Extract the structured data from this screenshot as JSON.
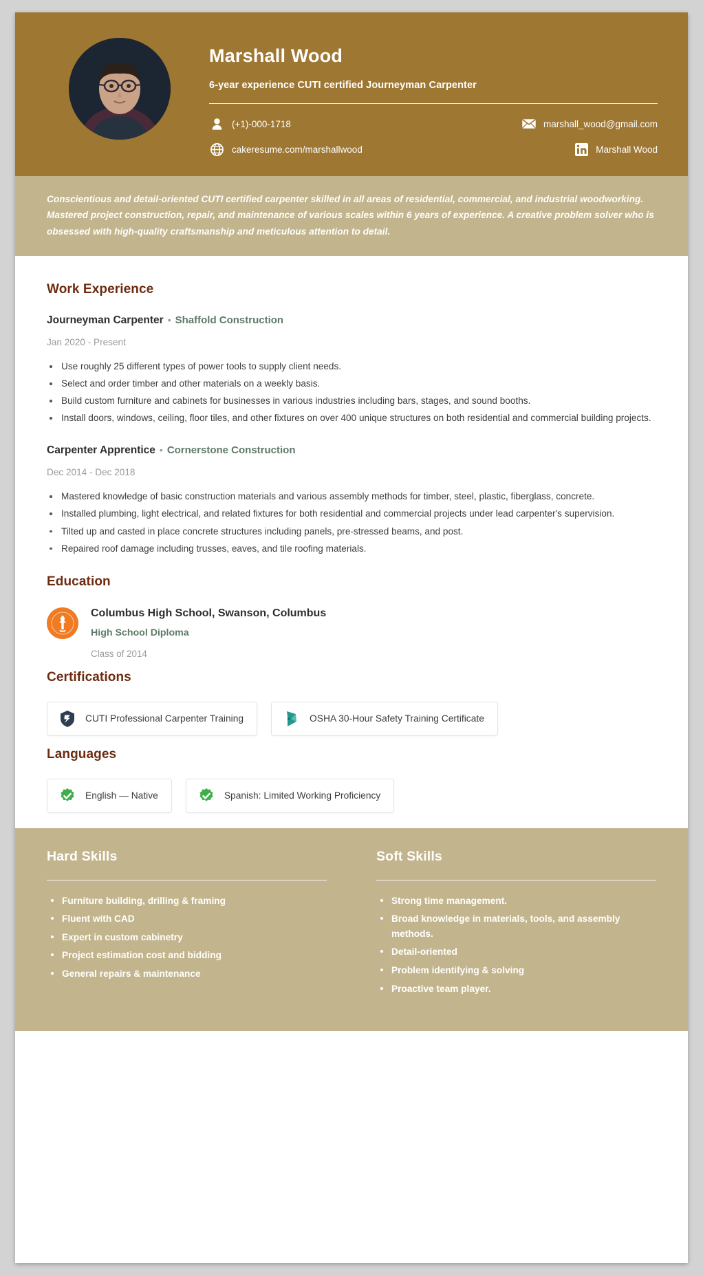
{
  "header": {
    "name": "Marshall Wood",
    "headline": "6-year experience CUTI certified Journeyman Carpenter",
    "background_color": "#9E7733",
    "contacts": [
      {
        "icon": "person-icon",
        "value": "(+1)-000-1718"
      },
      {
        "icon": "envelope-icon",
        "value": "marshall_wood@gmail.com"
      },
      {
        "icon": "globe-icon",
        "value": "cakeresume.com/marshallwood"
      },
      {
        "icon": "linkedin-icon",
        "value": "Marshall Wood"
      }
    ]
  },
  "summary": {
    "background_color": "#C2B48C",
    "text": "Conscientious and detail-oriented CUTI certified carpenter skilled in all areas of residential, commercial, and industrial woodworking. Mastered project construction, repair, and maintenance of various scales within 6 years of experience. A creative problem solver who is obsessed with high-quality craftsmanship and meticulous attention to detail."
  },
  "sections": {
    "work_experience": {
      "title": "Work Experience",
      "jobs": [
        {
          "title": "Journeyman Carpenter",
          "separator": "•",
          "company": "Shaffold Construction",
          "dates": "Jan 2020 - Present",
          "bullets": [
            "Use roughly 25 different types of power tools to supply client needs.",
            "Select and order timber and other materials on a weekly basis.",
            "Build custom furniture and cabinets for businesses in various industries including bars, stages, and sound booths.",
            "Install doors, windows, ceiling, floor tiles, and other fixtures on over 400 unique structures on both residential and commercial building projects."
          ]
        },
        {
          "title": "Carpenter Apprentice",
          "separator": "•",
          "company": "Cornerstone Construction",
          "dates": "Dec 2014 - Dec 2018",
          "bullets": [
            "Mastered knowledge of basic construction materials and various assembly methods for timber, steel, plastic, fiberglass, concrete.",
            "Installed plumbing, light electrical, and related fixtures for both residential and commercial projects under lead carpenter's supervision.",
            "Tilted up and casted in place concrete structures including panels, pre-stressed beams, and post.",
            "Repaired roof damage including trusses, eaves, and tile roofing materials."
          ]
        }
      ]
    },
    "education": {
      "title": "Education",
      "entries": [
        {
          "logo_icon": "torch-seal-icon",
          "logo_color": "#F07B23",
          "school": "Columbus High School, Swanson, Columbus",
          "degree": "High School Diploma",
          "class_of": "Class of 2014"
        }
      ]
    },
    "certifications": {
      "title": "Certifications",
      "items": [
        {
          "icon": "cuti-badge-icon",
          "icon_color": "#2D3E50",
          "label": "CUTI Professional Carpenter Training"
        },
        {
          "icon": "osha-badge-icon",
          "icon_color": "#21998E",
          "label": "OSHA 30-Hour Safety Training Certificate"
        }
      ]
    },
    "languages": {
      "title": "Languages",
      "items": [
        {
          "icon": "verified-check-icon",
          "icon_color": "#3EAE49",
          "label": "English — Native"
        },
        {
          "icon": "verified-check-icon",
          "icon_color": "#3EAE49",
          "label": "Spanish: Limited Working Proficiency"
        }
      ]
    },
    "hard_skills": {
      "title": "Hard Skills",
      "items": [
        "Furniture building, drilling & framing",
        "Fluent with CAD",
        "Expert in custom cabinetry",
        "Project estimation cost and bidding",
        "General repairs & maintenance"
      ]
    },
    "soft_skills": {
      "title": "Soft Skills",
      "items": [
        "Strong time management.",
        "Broad knowledge in materials, tools, and assembly methods.",
        "Detail-oriented",
        "Problem identifying & solving",
        "Proactive team player."
      ]
    }
  },
  "theme": {
    "gold": "#9E7733",
    "tan": "#C2B48C",
    "heading_brown": "#6d2b10",
    "company_green": "#5e7a68"
  }
}
